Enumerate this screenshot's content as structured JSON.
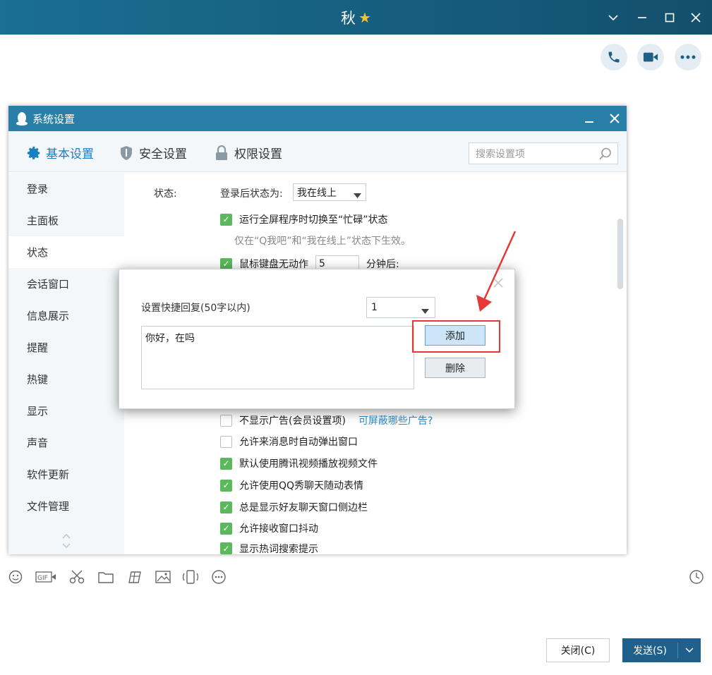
{
  "chat": {
    "title": "秋",
    "icons": [
      "chevron-down-icon",
      "minimize-icon",
      "maximize-icon",
      "close-icon",
      "phone-icon",
      "video-icon",
      "more-icon"
    ],
    "toolbar_icons": [
      "emoji-icon",
      "gif-icon",
      "scissors-icon",
      "folder-icon",
      "screenshot-icon",
      "image-icon",
      "shake-icon",
      "more-circle-icon",
      "history-clock-icon"
    ],
    "close_label": "关闭(C)",
    "send_label": "发送(S)"
  },
  "settings": {
    "title": "系统设置",
    "tabs": [
      {
        "label": "基本设置",
        "icon": "gear-icon",
        "active": true
      },
      {
        "label": "安全设置",
        "icon": "shield-icon",
        "active": false
      },
      {
        "label": "权限设置",
        "icon": "lock-icon",
        "active": false
      }
    ],
    "search_placeholder": "搜索设置项",
    "sidebar": [
      "登录",
      "主面板",
      "状态",
      "会话窗口",
      "信息展示",
      "提醒",
      "热键",
      "显示",
      "声音",
      "软件更新",
      "文件管理"
    ],
    "active_sidebar": "状态",
    "section_label": "状态:",
    "status_after_login_label": "登录后状态为:",
    "status_value": "我在线上",
    "fullscreen_busy": "运行全屏程序时切换至“忙碌”状态",
    "fullscreen_hint": "仅在“Q我吧”和“我在线上”状态下生效。",
    "idle_label": "鼠标键盘无动作",
    "idle_minutes": "5",
    "idle_suffix": "分钟后:",
    "options": [
      {
        "label": "不显示广告(会员设置项)",
        "checked": false,
        "link": "可屏蔽哪些广告?"
      },
      {
        "label": "允许来消息时自动弹出窗口",
        "checked": false
      },
      {
        "label": "默认使用腾讯视频播放视频文件",
        "checked": true
      },
      {
        "label": "允许使用QQ秀聊天随动表情",
        "checked": true
      },
      {
        "label": "总是显示好友聊天窗口侧边栏",
        "checked": true
      },
      {
        "label": "允许接收窗口抖动",
        "checked": true
      },
      {
        "label": "显示热词搜索提示",
        "checked": true
      }
    ]
  },
  "quick_reply": {
    "label": "设置快捷回复(50字以内)",
    "selected": "1",
    "text": "你好，在吗",
    "add_label": "添加",
    "delete_label": "删除"
  },
  "colors": {
    "accent": "#2a7fa8",
    "highlight": "#e53935",
    "check": "#5cb85c"
  }
}
